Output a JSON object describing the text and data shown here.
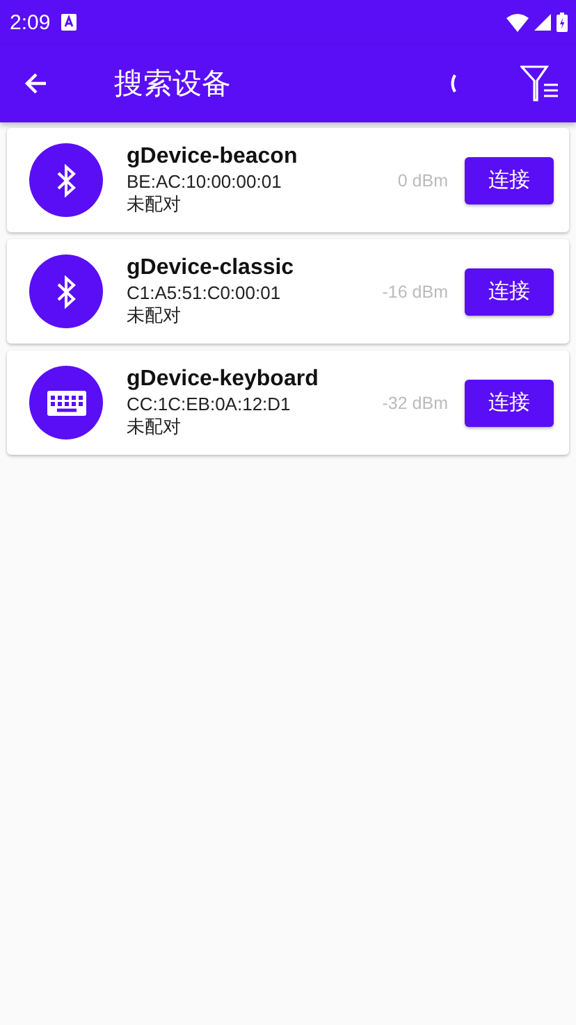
{
  "status_bar": {
    "time": "2:09"
  },
  "app_bar": {
    "title": "搜索设备",
    "scanning": true
  },
  "devices": [
    {
      "name": "gDevice-beacon",
      "address": "BE:AC:10:00:00:01",
      "bond_state": "未配对",
      "rssi": "0 dBm",
      "kind": "bluetooth",
      "button": "连接"
    },
    {
      "name": "gDevice-classic",
      "address": "C1:A5:51:C0:00:01",
      "bond_state": "未配对",
      "rssi": "-16 dBm",
      "kind": "bluetooth",
      "button": "连接"
    },
    {
      "name": "gDevice-keyboard",
      "address": "CC:1C:EB:0A:12:D1",
      "bond_state": "未配对",
      "rssi": "-32 dBm",
      "kind": "keyboard",
      "button": "连接"
    }
  ]
}
